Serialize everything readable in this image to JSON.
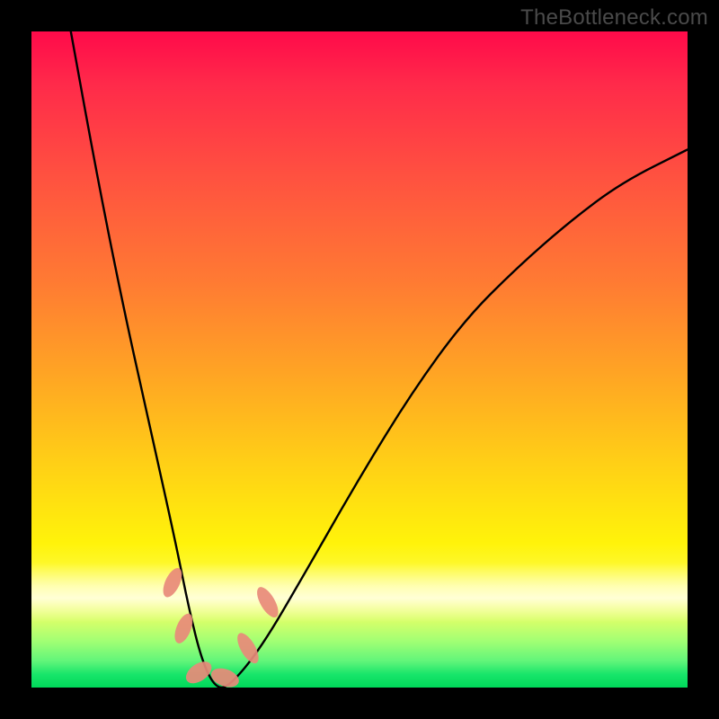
{
  "watermark": "TheBottleneck.com",
  "chart_data": {
    "type": "line",
    "title": "",
    "xlabel": "",
    "ylabel": "",
    "xlim": [
      0,
      100
    ],
    "ylim": [
      0,
      100
    ],
    "grid": false,
    "series": [
      {
        "name": "bottleneck-curve",
        "x": [
          6,
          10,
          14,
          18,
          22,
          24,
          26,
          28,
          30,
          35,
          42,
          50,
          58,
          66,
          74,
          82,
          90,
          100
        ],
        "values": [
          100,
          78,
          58,
          40,
          22,
          12,
          4,
          0,
          0,
          6,
          18,
          32,
          45,
          56,
          64,
          71,
          77,
          82
        ]
      }
    ],
    "markers": {
      "name": "valley-markers",
      "color": "#e88a7a",
      "points": [
        {
          "cx": 21.5,
          "cy": 16,
          "rx": 1.1,
          "ry": 2.4,
          "rot": 25
        },
        {
          "cx": 23.2,
          "cy": 9,
          "rx": 1.1,
          "ry": 2.4,
          "rot": 22
        },
        {
          "cx": 25.5,
          "cy": 2.3,
          "rx": 1.3,
          "ry": 2.2,
          "rot": 55
        },
        {
          "cx": 29.5,
          "cy": 1.5,
          "rx": 1.3,
          "ry": 2.2,
          "rot": 110
        },
        {
          "cx": 33.0,
          "cy": 6,
          "rx": 1.1,
          "ry": 2.6,
          "rot": -30
        },
        {
          "cx": 36.0,
          "cy": 13,
          "rx": 1.1,
          "ry": 2.6,
          "rot": -30
        }
      ]
    },
    "background_gradient": {
      "top": "#ff0a4a",
      "mid": "#ffd016",
      "bottom": "#00d85a"
    }
  }
}
